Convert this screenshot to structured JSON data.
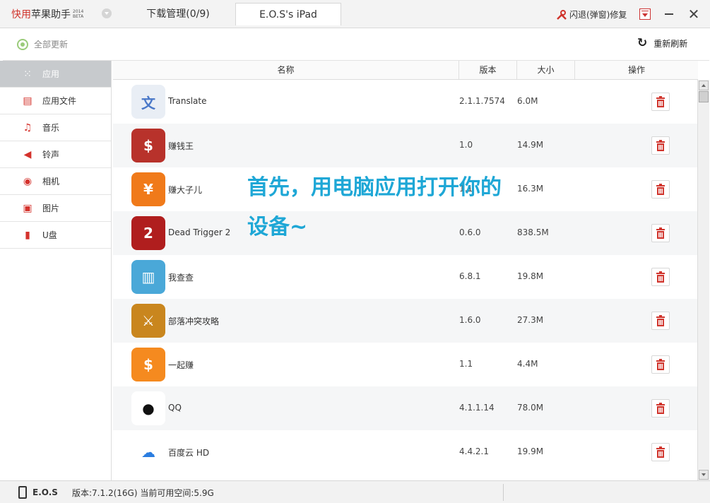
{
  "titlebar": {
    "brand_red": "快用",
    "brand_rest": "苹果助手",
    "brand_year": "2014",
    "brand_beta": "BETA",
    "tab_downloads": "下载管理(0/9)",
    "tab_device": "E.O.S's iPad",
    "repair_label": "闪退(弹窗)修复"
  },
  "toolbar": {
    "update_all": "全部更新",
    "refresh": "重新刷新"
  },
  "sidebar": {
    "items": [
      {
        "label": "应用",
        "icon": "grid-icon",
        "active": true
      },
      {
        "label": "应用文件",
        "icon": "document-icon"
      },
      {
        "label": "音乐",
        "icon": "music-icon"
      },
      {
        "label": "铃声",
        "icon": "speaker-icon"
      },
      {
        "label": "相机",
        "icon": "camera-icon"
      },
      {
        "label": "图片",
        "icon": "image-icon"
      },
      {
        "label": "U盘",
        "icon": "usb-icon"
      }
    ]
  },
  "table": {
    "headers": {
      "name": "名称",
      "version": "版本",
      "size": "大小",
      "action": "操作"
    },
    "rows": [
      {
        "name": "Translate",
        "version": "2.1.1.7574",
        "size": "6.0M",
        "icon": "translate-icon",
        "color": "#e9eef5"
      },
      {
        "name": "赚钱王",
        "version": "1.0",
        "size": "14.9M",
        "icon": "coin-icon",
        "color": "#b8322b"
      },
      {
        "name": "赚大子儿",
        "version": "1.1",
        "size": "16.3M",
        "icon": "yen-icon",
        "color": "#f07a1a"
      },
      {
        "name": "Dead Trigger 2",
        "version": "0.6.0",
        "size": "838.5M",
        "icon": "dead-trigger-icon",
        "color": "#b01e1e"
      },
      {
        "name": "我查查",
        "version": "6.8.1",
        "size": "19.8M",
        "icon": "barcode-icon",
        "color": "#4aa8d8"
      },
      {
        "name": "部落冲突攻略",
        "version": "1.6.0",
        "size": "27.3M",
        "icon": "clash-icon",
        "color": "#c9861e"
      },
      {
        "name": "一起赚",
        "version": "1.1",
        "size": "4.4M",
        "icon": "money-bag-icon",
        "color": "#f58a1f"
      },
      {
        "name": "QQ",
        "version": "4.1.1.14",
        "size": "78.0M",
        "icon": "penguin-icon",
        "color": "#ffffff"
      },
      {
        "name": "百度云 HD",
        "version": "4.4.2.1",
        "size": "19.9M",
        "icon": "cloud-icon",
        "color": "#ffffff"
      }
    ]
  },
  "overlay": {
    "line1": "首先，用电脑应用打开你的",
    "line2": "设备~"
  },
  "statusbar": {
    "device": "E.O.S",
    "info": "版本:7.1.2(16G) 当前可用空间:5.9G"
  }
}
